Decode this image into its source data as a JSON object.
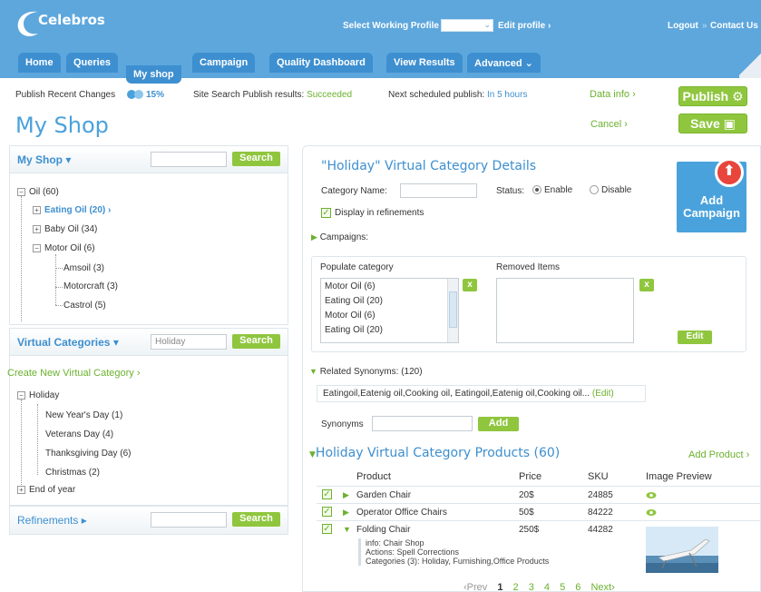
{
  "header": {
    "logo_text": "Celebros",
    "profile_label": "Select Working Profile",
    "edit_profile": "Edit profile ›",
    "logout": "Logout",
    "separator": "»",
    "contact": "Contact Us",
    "tabs": [
      "Home",
      "Queries",
      "My shop",
      "Campaign",
      "Quality Dashboard",
      "View Results",
      "Advanced ⌄"
    ]
  },
  "publish": {
    "recent": "Publish Recent Changes",
    "percent": "15%",
    "site_search_label": "Site Search Publish results:",
    "site_search_status": "Succeeded",
    "next_label": "Next scheduled publish:",
    "next_value": "In 5 hours",
    "data_info": "Data info ›",
    "publish_btn": "Publish",
    "save_btn": "Save",
    "cancel": "Cancel ›"
  },
  "page_title": "My Shop",
  "sidebar": {
    "myshop": {
      "title": "My Shop ▾",
      "search_btn": "Search",
      "tree": [
        "Oil (60)",
        "Eating Oil (20) ›",
        "Baby Oil (34)",
        "Motor Oil (6)",
        "Amsoil (3)",
        "Motorcraft (3)",
        "Castrol (5)"
      ]
    },
    "virtual": {
      "title": "Virtual Categories ▾",
      "input_value": "Holiday",
      "search_btn": "Search",
      "create": "Create New Virtual Category ›",
      "tree": [
        "Holiday",
        "New Year's Day (1)",
        "Veterans Day (4)",
        "Thanksgiving Day (6)",
        "Christmas (2)",
        "End of year"
      ]
    },
    "refinements": {
      "title": "Refinements ▸",
      "search_btn": "Search"
    }
  },
  "details": {
    "title": "\"Holiday\" Virtual Category Details",
    "category_name_label": "Category Name:",
    "status_label": "Status:",
    "enable": "Enable",
    "disable": "Disable",
    "display_refinements": "Display in refinements",
    "campaigns": "Campaigns:",
    "add_campaign": "Add Campaign",
    "populate_label": "Populate category",
    "populate_items": [
      "Motor Oil (6)",
      "Eating Oil (20)",
      "Motor Oil (6)",
      "Eating Oil (20)"
    ],
    "removed_label": "Removed Items",
    "x_label": "x",
    "edit_btn": "Edit",
    "synonyms_header": "Related Synonyms: (120)",
    "synonyms_text": "Eatingoil,Eatenig oil,Cooking oil, Eatingoil,Eatenig oil,Cooking oil...",
    "synonyms_edit": "(Edit)",
    "synonyms_label": "Synonyms",
    "add_btn": "Add"
  },
  "products": {
    "title": "Holiday  Virtual Category  Products (60)",
    "add_product": "Add Product ›",
    "columns": [
      "Product",
      "Price",
      "SKU",
      "Image Preview"
    ],
    "rows": [
      {
        "name": "Garden Chair",
        "price": "20$",
        "sku": "24885"
      },
      {
        "name": "Operator Office Chairs",
        "price": "50$",
        "sku": "84222"
      },
      {
        "name": "Folding Chair",
        "price": "250$",
        "sku": "44282"
      }
    ],
    "info": {
      "line1": "info: Chair Shop",
      "line2": "Actions: Spell Corrections",
      "line3": "Categories (3): Holiday, Furnishing,Office Products"
    }
  },
  "pager": {
    "prev": "‹Prev",
    "pages": [
      "1",
      "2",
      "3",
      "4",
      "5",
      "6"
    ],
    "current": "1",
    "next": "Next›"
  },
  "colors": {
    "header_blue": "#5ea7dd",
    "tab_blue": "#3d8fd0",
    "accent_green": "#8fc63e",
    "link_green": "#6bb12e"
  }
}
